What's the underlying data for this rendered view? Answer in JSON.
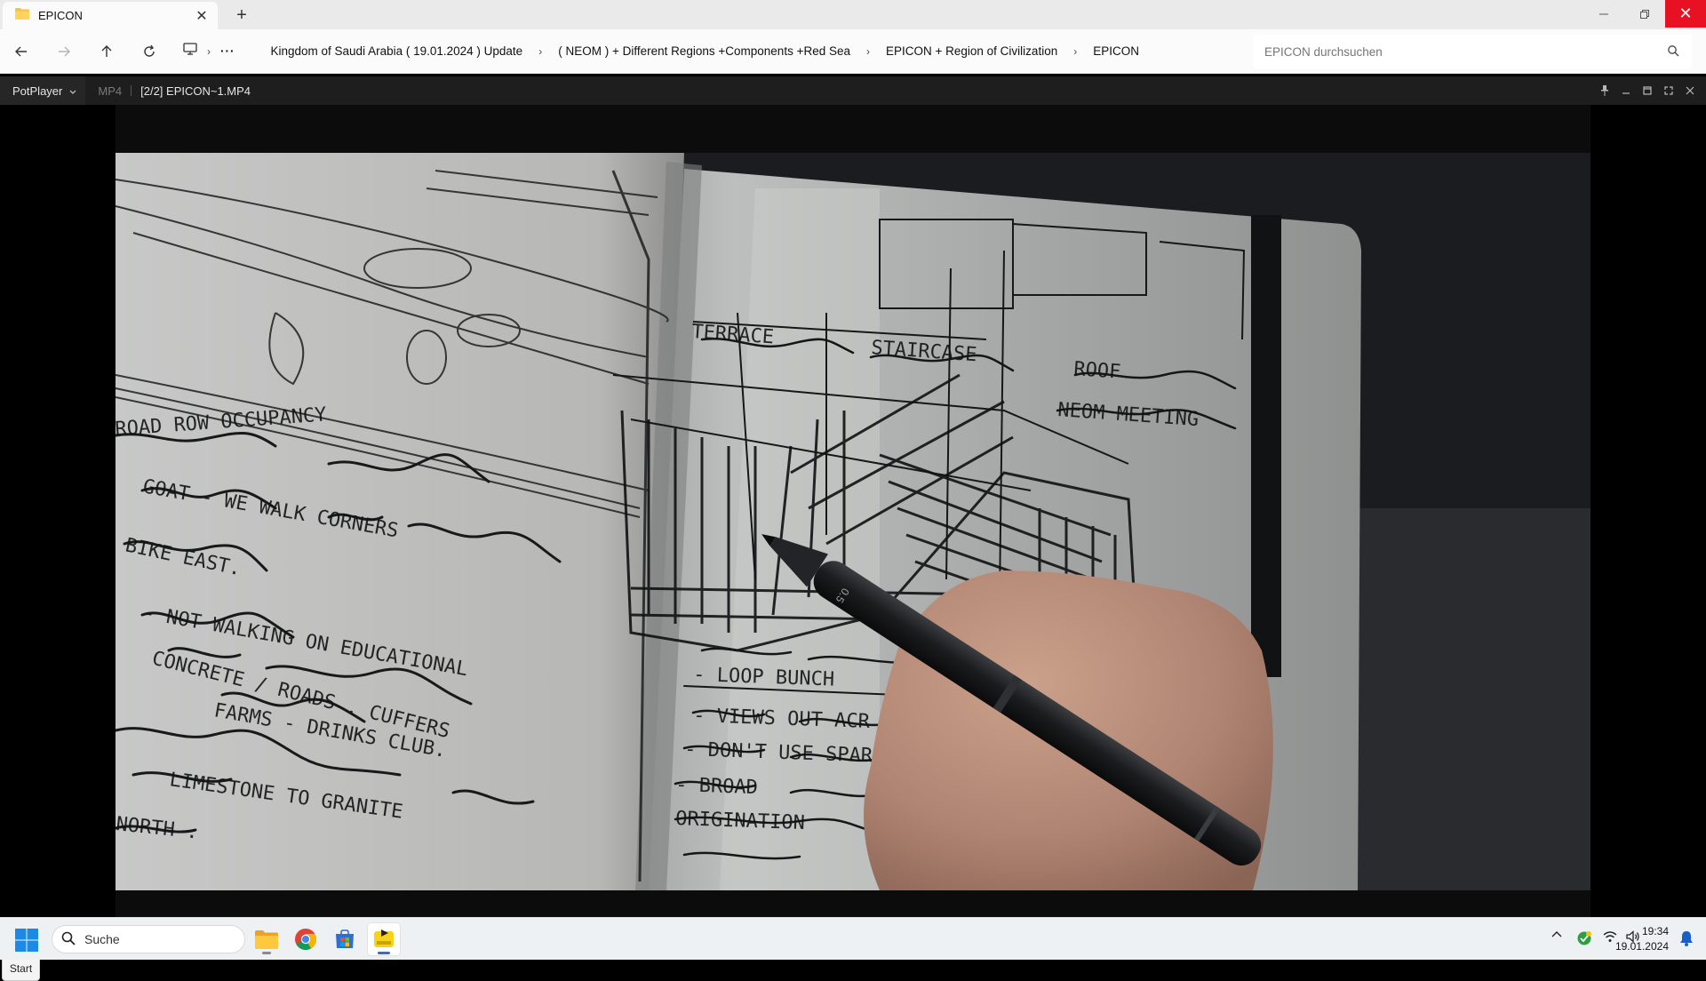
{
  "explorer": {
    "tab_title": "EPICON",
    "breadcrumb": [
      "Kingdom of Saudi Arabia ( 19.01.2024 ) Update",
      "( NEOM ) + Different Regions +Components +Red Sea",
      "EPICON + Region of Civilization",
      "EPICON"
    ],
    "search_placeholder": "EPICON durchsuchen"
  },
  "player": {
    "app_menu": "PotPlayer",
    "format": "MP4",
    "file_title": "[2/2] EPICON~1.MP4",
    "start_button": "Start",
    "video_frame_text": {
      "left_page": [
        "ROAD ROW OCCUPANCY",
        "GOAT - WE WALK CORNERS",
        "BIKE EAST.",
        "- NOT WALKING ON EDUCATIONAL",
        "CONCRETE / ROADS . CUFFERS",
        "FARMS - DRINKS CLUB.",
        "LIMESTONE TO GRANITE",
        "NORTH ."
      ],
      "right_page": [
        "TERRACE",
        "STAIRCASE",
        "ROOF",
        "NEOM MEETING",
        "- LOOP BUNCH",
        "- VIEWS OUT ACR",
        "- DON'T USE SPAR",
        "- BROAD",
        "ORIGINATION"
      ]
    }
  },
  "taskbar": {
    "search_label": "Suche",
    "time": "19:34",
    "date": "19.01.2024"
  },
  "colors": {
    "close_red": "#e81123",
    "player_bg": "#000000",
    "taskbar_bg": "#eef1f4",
    "folder_yellow": "#f5c242"
  }
}
